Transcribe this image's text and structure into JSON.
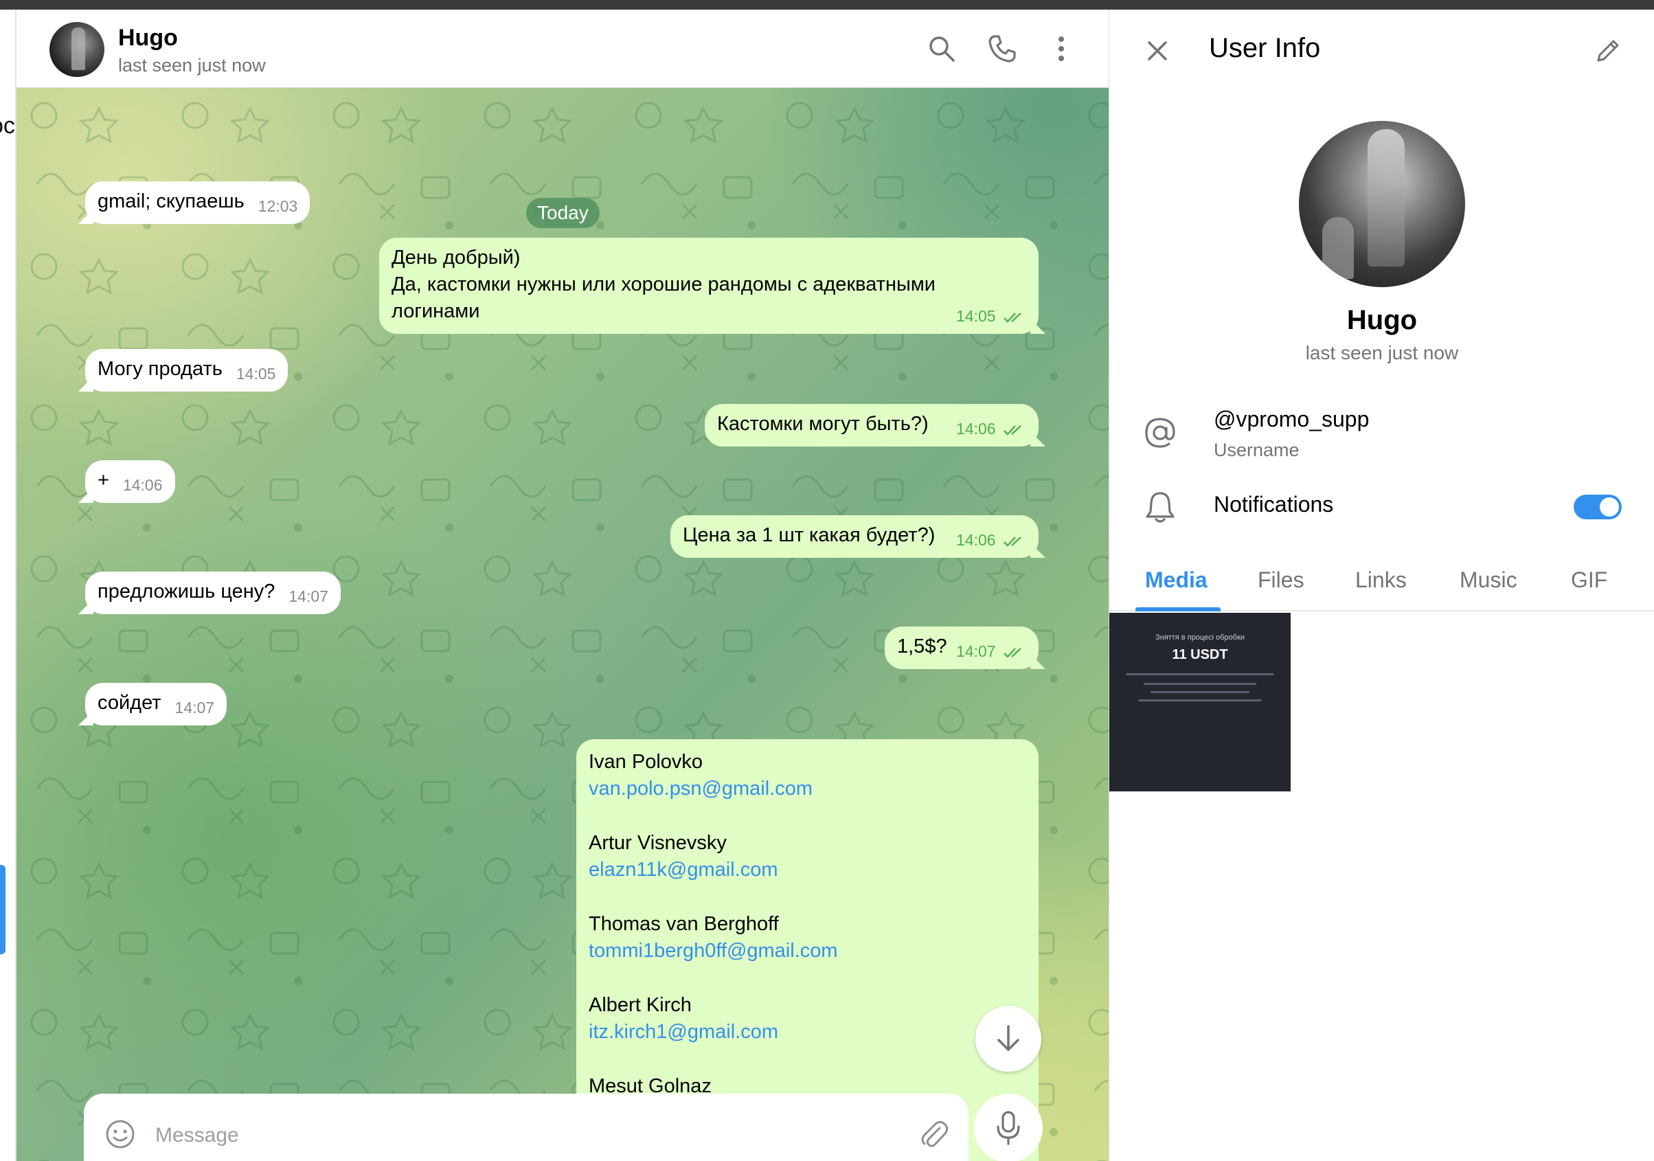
{
  "left_pane": {
    "cut_text": "oc"
  },
  "chat": {
    "name": "Hugo",
    "status": "last seen just now",
    "date_chip": "Today",
    "messages": {
      "m1": {
        "text": "gmail; скупаешь",
        "time": "12:03"
      },
      "m2": {
        "line1": "День добрый)",
        "line2": "Да, кастомки нужны или хорошие рандомы с адекватными",
        "line3": "логинами",
        "time": "14:05"
      },
      "m3": {
        "text": "Могу продать",
        "time": "14:05"
      },
      "m4": {
        "text": "Кастомки могут быть?)",
        "time": "14:06"
      },
      "m5": {
        "text": "+",
        "time": "14:06"
      },
      "m6": {
        "text": "Цена за 1 шт какая будет?)",
        "time": "14:06"
      },
      "m7": {
        "text": "предложишь цену?",
        "time": "14:07"
      },
      "m8": {
        "text": "1,5$?",
        "time": "14:07"
      },
      "m9": {
        "text": "сойдет",
        "time": "14:07"
      }
    },
    "contacts": [
      {
        "name": "Ivan Polovko",
        "email": "van.polo.psn@gmail.com"
      },
      {
        "name": "Artur Visnevsky",
        "email": "elazn11k@gmail.com"
      },
      {
        "name": "Thomas van Berghoff",
        "email": "tommi1bergh0ff@gmail.com"
      },
      {
        "name": "Albert Kirch",
        "email": "itz.kirch1@gmail.com"
      },
      {
        "name": "Mesut Golnaz",
        "email": ""
      }
    ],
    "composer_placeholder": "Message"
  },
  "info": {
    "title": "User Info",
    "name": "Hugo",
    "status": "last seen just now",
    "username": "@vpromo_supp",
    "username_label": "Username",
    "notifications_label": "Notifications",
    "notifications_on": true,
    "tabs": [
      "Media",
      "Files",
      "Links",
      "Music",
      "GIF"
    ],
    "active_tab": "Media",
    "media": {
      "caption": "Зняття в процесі обробки",
      "amount": "11 USDT"
    }
  },
  "colors": {
    "accent": "#3390ec",
    "outgoing_bubble": "#e0fdc5",
    "read_ticks": "#4fae4e"
  }
}
